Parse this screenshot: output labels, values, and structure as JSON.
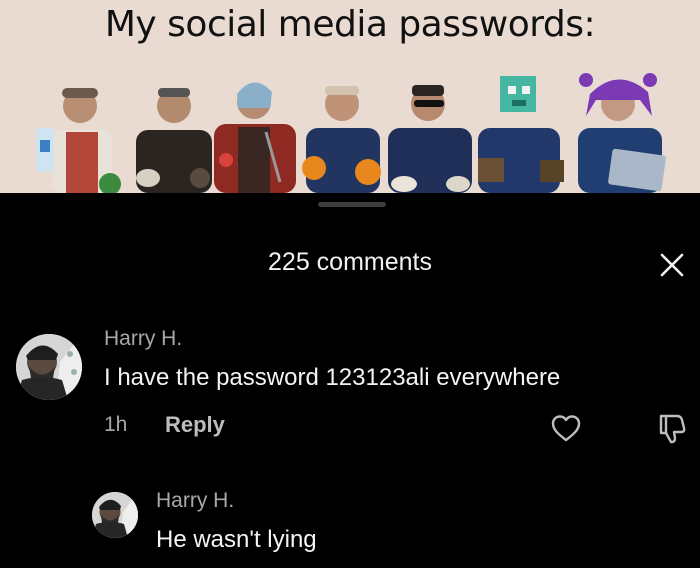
{
  "meme": {
    "title": "My social media passwords:"
  },
  "comments_panel": {
    "count_label": "225 comments",
    "close_icon": "close-icon",
    "comments": [
      {
        "author": "Harry H.",
        "text": "I have the password 123123ali everywhere",
        "time": "1h",
        "reply_label": "Reply",
        "like_icon": "heart-icon",
        "dislike_icon": "thumbs-down-icon"
      },
      {
        "author": "Harry H.",
        "text": "He wasn't lying"
      }
    ]
  },
  "colors": {
    "meme_bg": "#eadbd2",
    "panel_bg": "#000000",
    "text_primary": "#f4f4f4",
    "text_secondary": "#a8a8a8"
  }
}
